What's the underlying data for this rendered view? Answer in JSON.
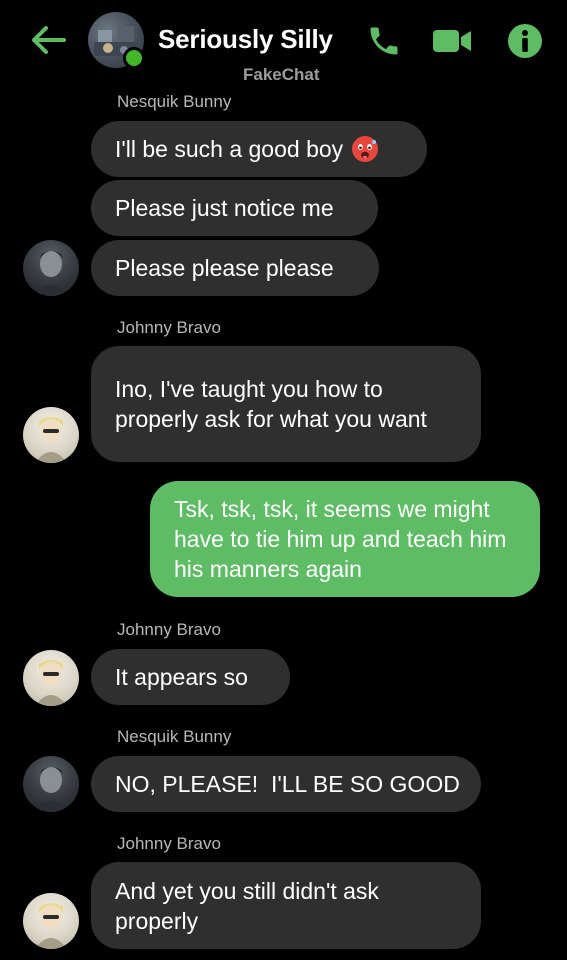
{
  "header": {
    "title": "Seriously Silly",
    "subtitle": "FakeChat",
    "back_icon": "arrow-left-icon",
    "call_icon": "phone-icon",
    "video_icon": "video-camera-icon",
    "info_icon": "info-icon",
    "accent_color": "#5ebd64",
    "online_color": "#42b72a"
  },
  "messages": [
    {
      "sender": "Nesquik Bunny",
      "texts": [
        "I'll be such a good boy",
        "Please just notice me",
        "Please please please"
      ],
      "emoji": "hot-face-emoji"
    },
    {
      "sender": "Johnny Bravo",
      "text": "Ino, I've taught you how to properly ask for what you want"
    },
    {
      "outgoing": true,
      "text": "Tsk, tsk, tsk, it seems we might have to tie him up and teach him his manners again"
    },
    {
      "sender": "Johnny Bravo",
      "text": "It appears so"
    },
    {
      "sender": "Nesquik Bunny",
      "text": "NO, PLEASE!  I'LL BE SO GOOD"
    },
    {
      "sender": "Johnny Bravo",
      "text": "And yet you still didn't ask properly"
    }
  ],
  "colors": {
    "incoming_bubble": "#2f2f2f",
    "outgoing_bubble": "#5ebd64",
    "background": "#000000"
  }
}
